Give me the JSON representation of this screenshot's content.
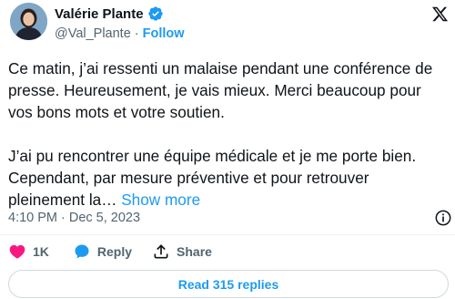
{
  "author": {
    "display_name": "Valérie Plante",
    "handle": "@Val_Plante",
    "separator": "·",
    "follow_label": "Follow",
    "verified_color": "#1d9bf0"
  },
  "tweet": {
    "paragraph1": "Ce matin, j’ai ressenti un malaise pendant une conférence de presse. Heureusement, je vais mieux. Merci beaucoup pour vos bons mots et votre soutien.",
    "paragraph2": "J’ai pu rencontrer une équipe médicale et je me porte bien. Cependant, par mesure préventive et pour retrouver pleinement la…",
    "show_more_label": "Show more"
  },
  "meta": {
    "time": "4:10 PM",
    "separator": "·",
    "date": "Dec 5, 2023"
  },
  "actions": {
    "like_count": "1K",
    "reply_label": "Reply",
    "share_label": "Share"
  },
  "read_replies_label": "Read 315 replies",
  "colors": {
    "accent": "#1d9bf0",
    "like": "#f91880",
    "text": "#0f1419",
    "muted": "#536471",
    "border": "#cfd9de"
  },
  "icons": {
    "verified": "verified-badge-icon",
    "platform": "x-logo-icon",
    "info": "info-icon",
    "like": "heart-icon",
    "reply": "speech-bubble-icon",
    "share": "share-upload-icon"
  }
}
